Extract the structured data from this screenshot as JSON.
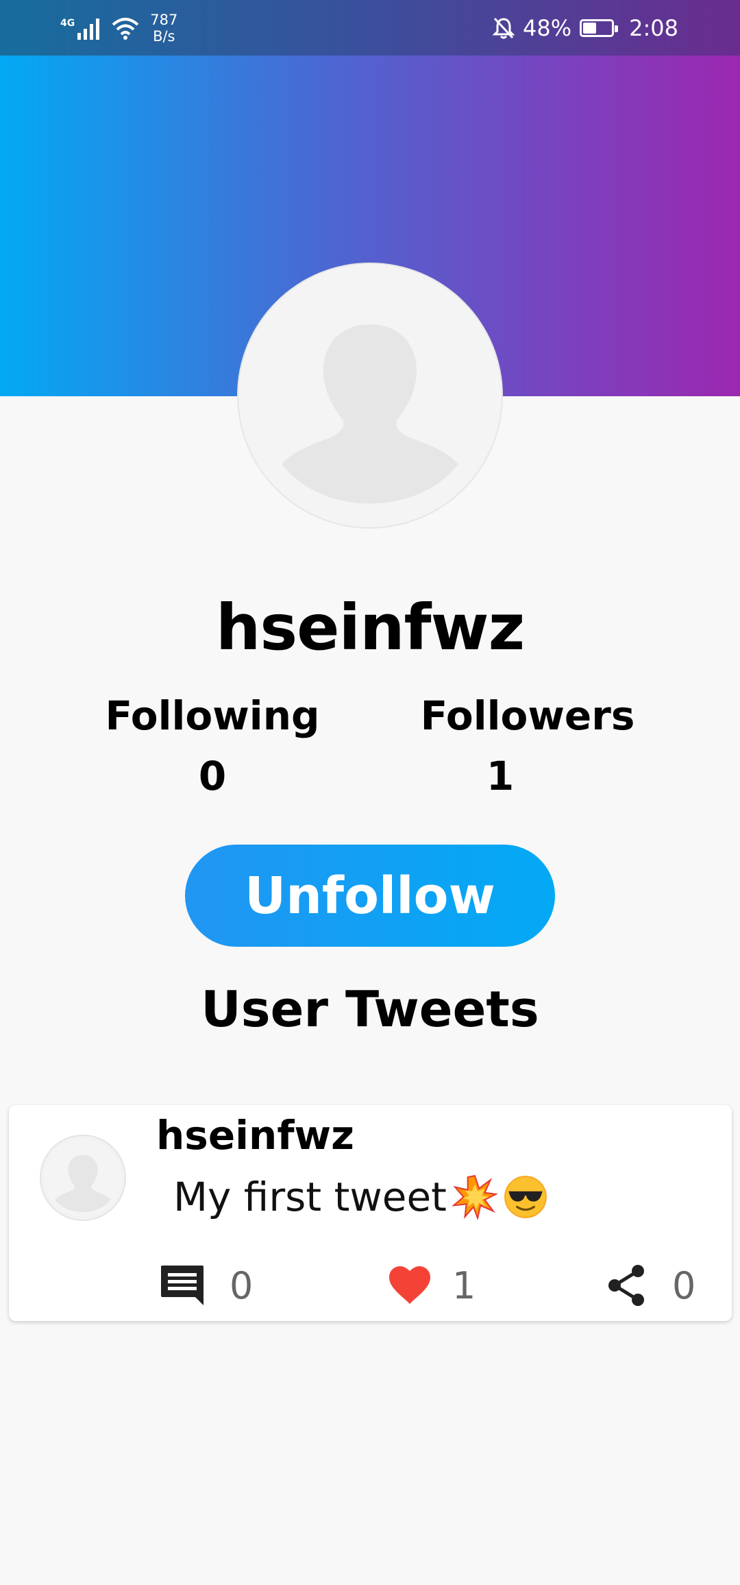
{
  "status_bar": {
    "network": "4G",
    "speed_value": "787",
    "speed_unit": "B/s",
    "battery_percent": "48%",
    "battery_level": 0.48,
    "time": "2:08",
    "icons": [
      "signal-icon",
      "wifi-icon",
      "bell-muted-icon",
      "battery-icon"
    ]
  },
  "colors": {
    "banner_start": "#03a9f4",
    "banner_end": "#9c27b0",
    "button_start": "#2196f3",
    "button_end": "#03a9f4",
    "like": "#f44336"
  },
  "profile": {
    "username": "hseinfwz",
    "following_label": "Following",
    "following_count": "0",
    "followers_label": "Followers",
    "followers_count": "1",
    "unfollow_label": "Unfollow"
  },
  "section_title": "User Tweets",
  "tweets": [
    {
      "user": "hseinfwz",
      "text": "My first tweet",
      "emojis": [
        "💥",
        "😎"
      ],
      "comments": "0",
      "likes": "1",
      "shares": "0"
    }
  ]
}
